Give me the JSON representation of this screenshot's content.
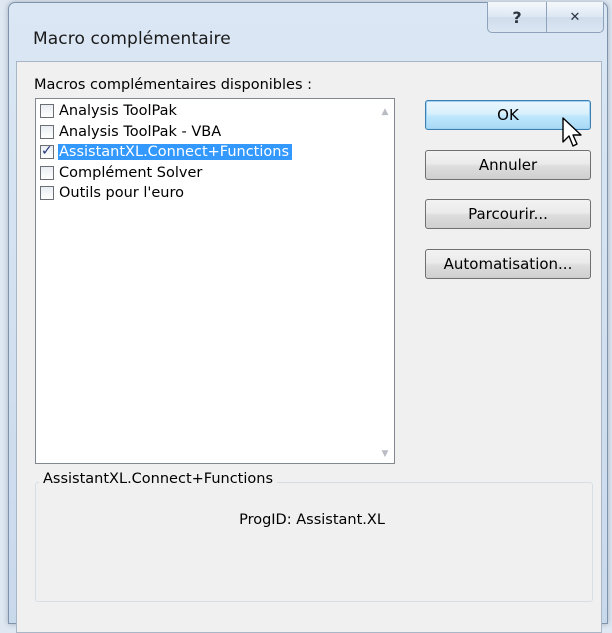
{
  "window": {
    "title": "Macro complémentaire",
    "help_glyph": "?",
    "close_glyph": "✕"
  },
  "list": {
    "label": "Macros complémentaires disponibles :",
    "items": [
      {
        "label": "Analysis ToolPak",
        "checked": false,
        "selected": false
      },
      {
        "label": "Analysis ToolPak - VBA",
        "checked": false,
        "selected": false
      },
      {
        "label": "AssistantXL.Connect+Functions",
        "checked": true,
        "selected": true
      },
      {
        "label": "Complément Solver",
        "checked": false,
        "selected": false
      },
      {
        "label": "Outils pour l'euro",
        "checked": false,
        "selected": false
      }
    ]
  },
  "buttons": {
    "ok": "OK",
    "cancel": "Annuler",
    "browse": "Parcourir...",
    "automation": "Automatisation..."
  },
  "details": {
    "title": "AssistantXL.Connect+Functions",
    "progid": "ProgID: Assistant.XL"
  },
  "colors": {
    "selection": "#3399ff",
    "default_button": "#bee6fd"
  }
}
